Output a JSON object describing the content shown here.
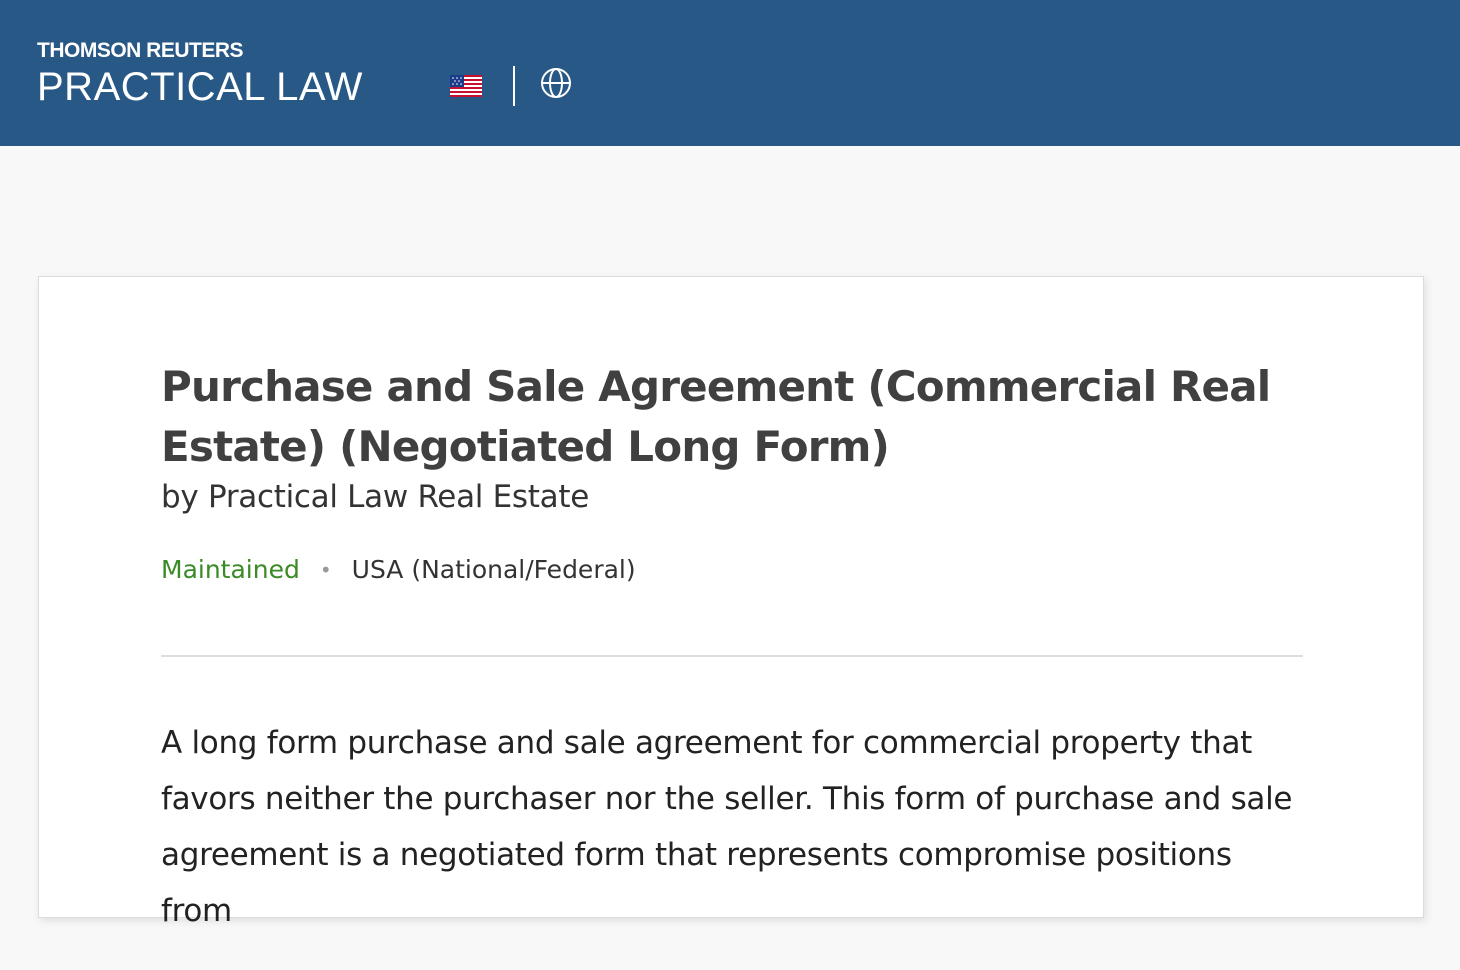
{
  "header": {
    "brand_top": "THOMSON REUTERS",
    "brand_bottom": "PRACTICAL LAW",
    "flag_icon": "us-flag-icon",
    "globe_icon": "globe-icon",
    "background_color": "#285886"
  },
  "document": {
    "title": "Purchase and Sale Agreement (Commercial Real Estate) (Negotiated Long Form)",
    "author": "by Practical Law Real Estate",
    "status": "Maintained",
    "status_color": "#3a8a25",
    "separator": "•",
    "jurisdiction": "USA (National/Federal)",
    "abstract": "A long form purchase and sale agreement for commercial property that favors neither the purchaser nor the seller. This form of purchase and sale agreement is a negotiated form that represents compromise positions from"
  }
}
